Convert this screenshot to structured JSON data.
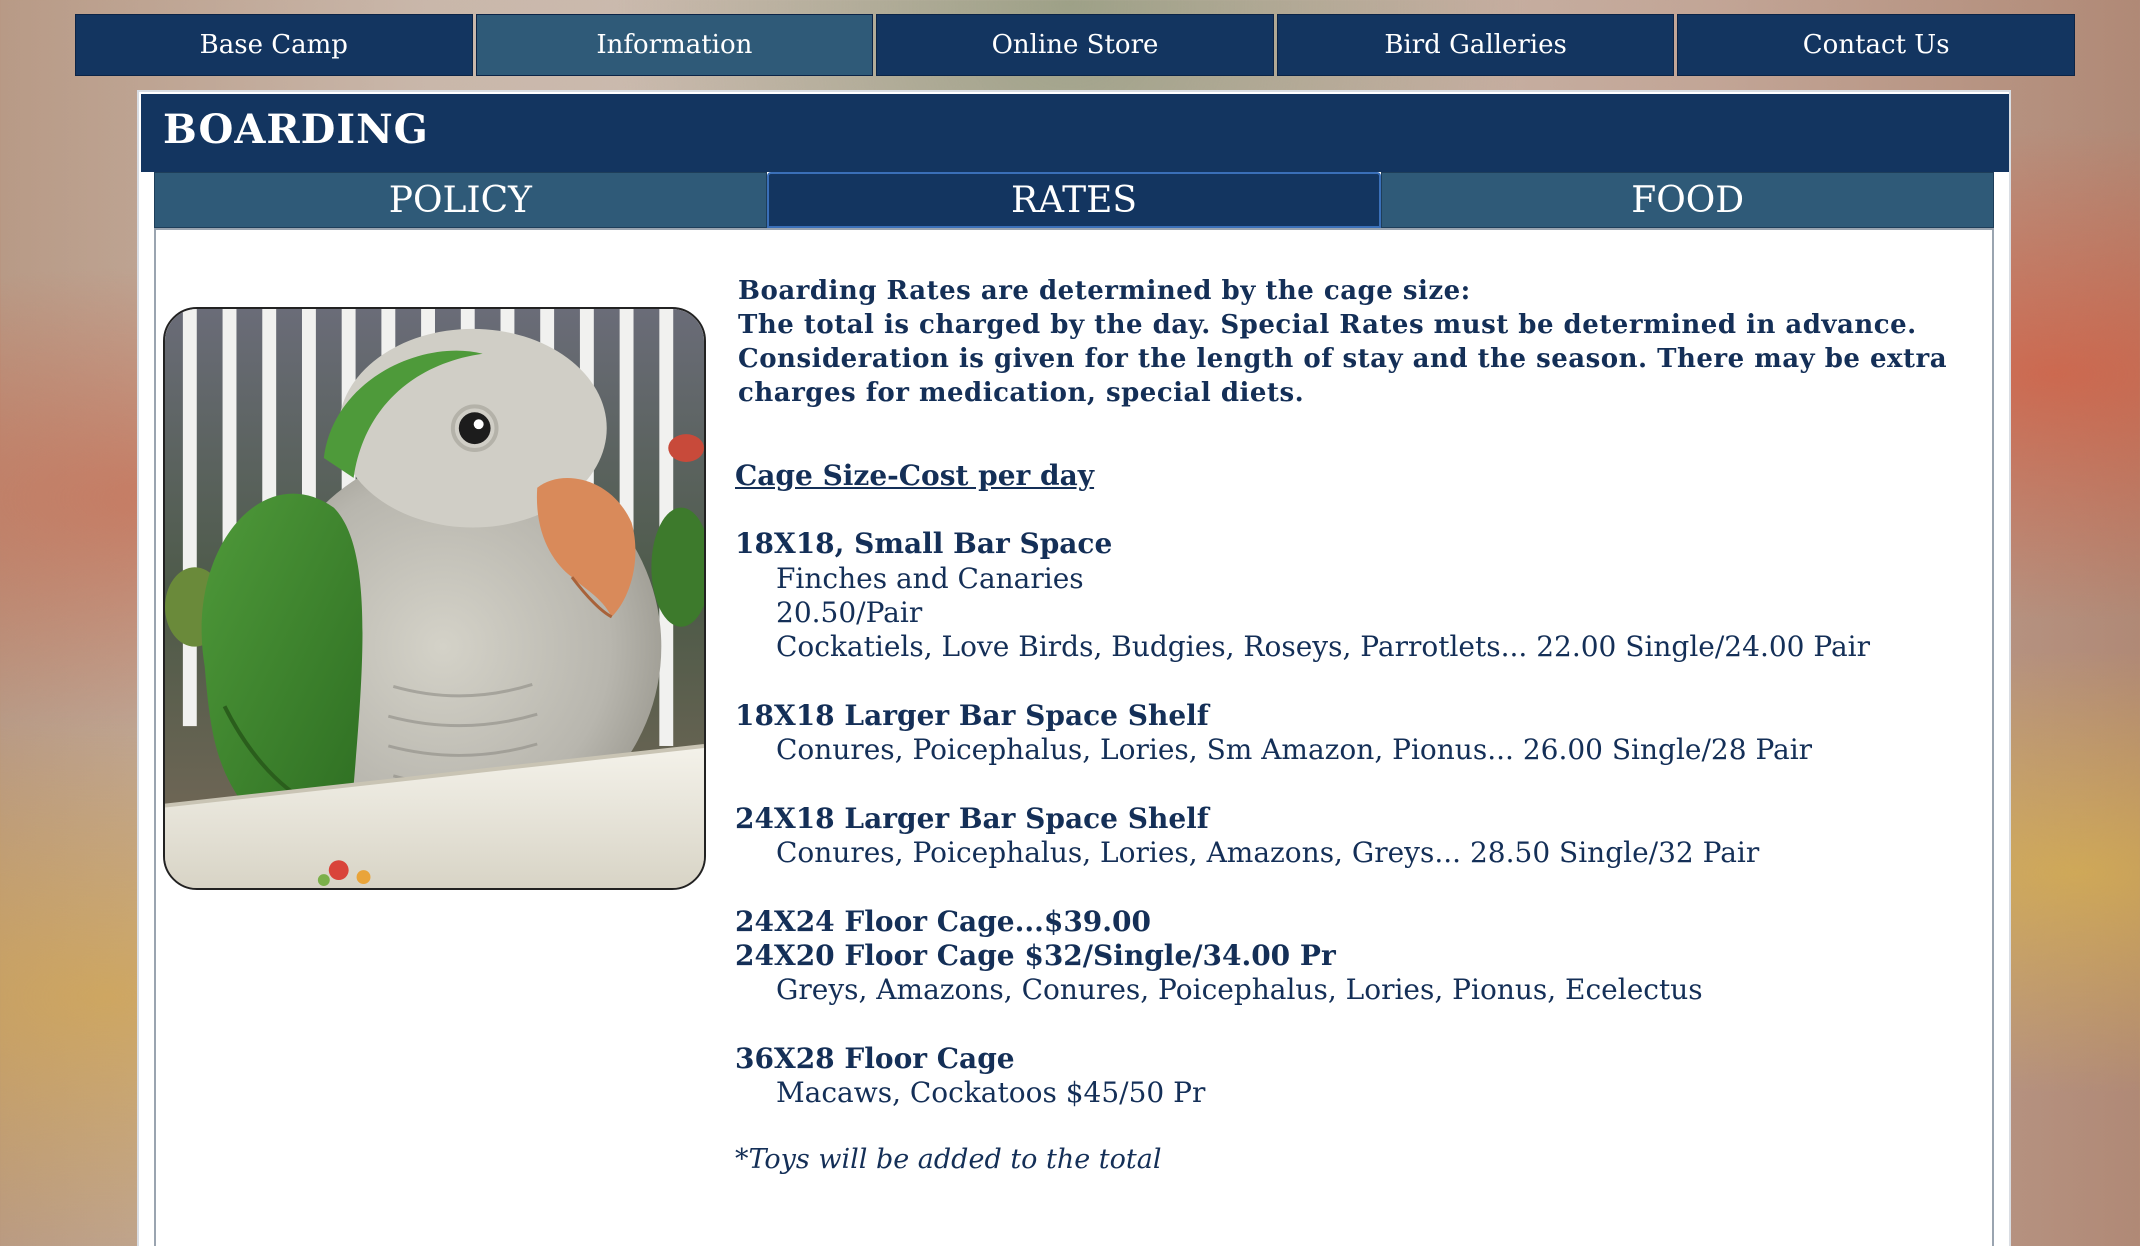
{
  "nav": {
    "items": [
      {
        "label": "Base Camp",
        "active": false
      },
      {
        "label": "Information",
        "active": true
      },
      {
        "label": "Online Store",
        "active": false
      },
      {
        "label": "Bird Galleries",
        "active": false
      },
      {
        "label": "Contact Us",
        "active": false
      }
    ]
  },
  "panel": {
    "title": "BOARDING"
  },
  "tabs": [
    {
      "label": "POLICY",
      "active": false
    },
    {
      "label": "RATES",
      "active": true
    },
    {
      "label": "FOOD",
      "active": false
    }
  ],
  "rates": {
    "intro_lines": [
      "Boarding Rates are determined by the cage size:",
      "The total is charged by the day.  Special Rates must be determined in advance.",
      "Consideration is given for the length of stay and the season.  There may be extra",
      "charges for medication, special diets."
    ],
    "section_heading": "Cage Size-Cost per day",
    "cage_small": {
      "title": "18X18, Small Bar Space",
      "lines": [
        "Finches and Canaries",
        "20.50/Pair",
        "Cockatiels, Love Birds, Budgies, Roseys, Parrotlets... 22.00 Single/24.00 Pair"
      ]
    },
    "cage_larger_18": {
      "title": "18X18 Larger Bar Space Shelf",
      "lines": [
        "Conures, Poicephalus, Lories, Sm Amazon, Pionus... 26.00 Single/28 Pair"
      ]
    },
    "cage_larger_24": {
      "title": "24X18 Larger Bar Space Shelf",
      "lines": [
        "Conures, Poicephalus, Lories,  Amazons, Greys... 28.50 Single/32 Pair"
      ]
    },
    "floor_24x24": "24X24 Floor Cage...$39.00",
    "floor_24x20": {
      "title": "24X20 Floor Cage $32/Single/34.00 Pr",
      "lines": [
        "Greys, Amazons, Conures, Poicephalus, Lories, Pionus,  Ecelectus"
      ]
    },
    "floor_36x28": {
      "title": "36X28 Floor Cage",
      "lines": [
        "Macaws, Cockatoos $45/50 Pr"
      ]
    },
    "note": "*Toys will be added to the total"
  },
  "colors": {
    "navy": "#133560",
    "steel_blue": "#2f5a78",
    "text": "#142f57"
  }
}
